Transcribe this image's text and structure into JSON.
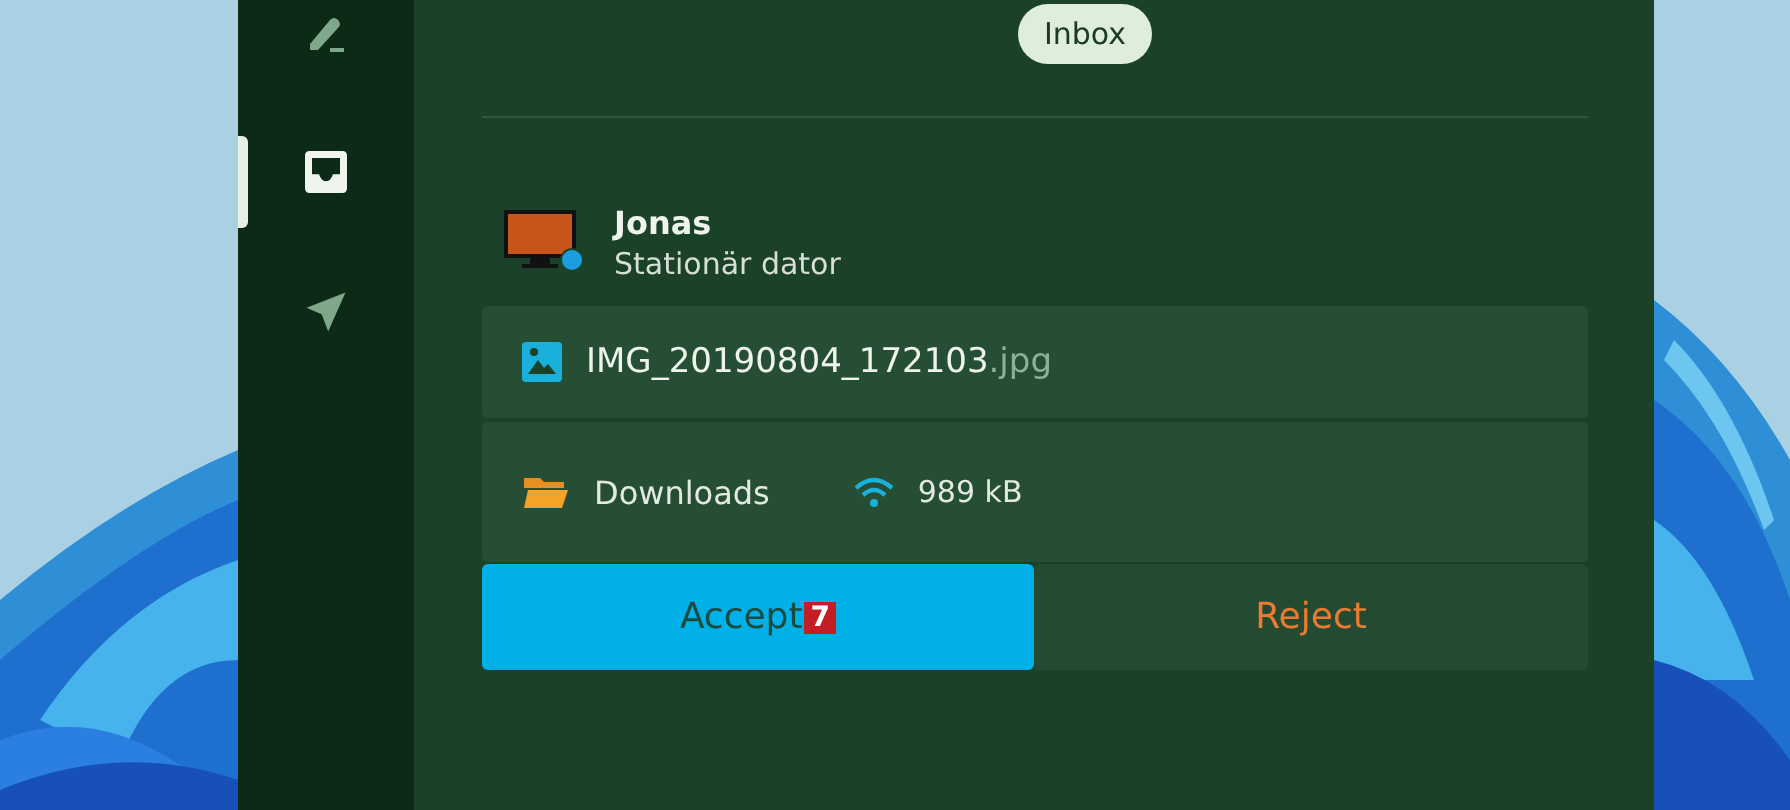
{
  "sidebar": {
    "items": [
      {
        "kind": "compose",
        "selected": false
      },
      {
        "kind": "inbox",
        "selected": true
      },
      {
        "kind": "send",
        "selected": false
      }
    ]
  },
  "header": {
    "chip": "Inbox"
  },
  "sender": {
    "name": "Jonas",
    "device": "Stationär dator"
  },
  "file": {
    "name": "IMG_20190804_172103",
    "extension": ".jpg"
  },
  "transfer": {
    "folder": "Downloads",
    "size": "989 kB"
  },
  "actions": {
    "accept": "Accept",
    "accept_badge": "7",
    "reject": "Reject"
  }
}
